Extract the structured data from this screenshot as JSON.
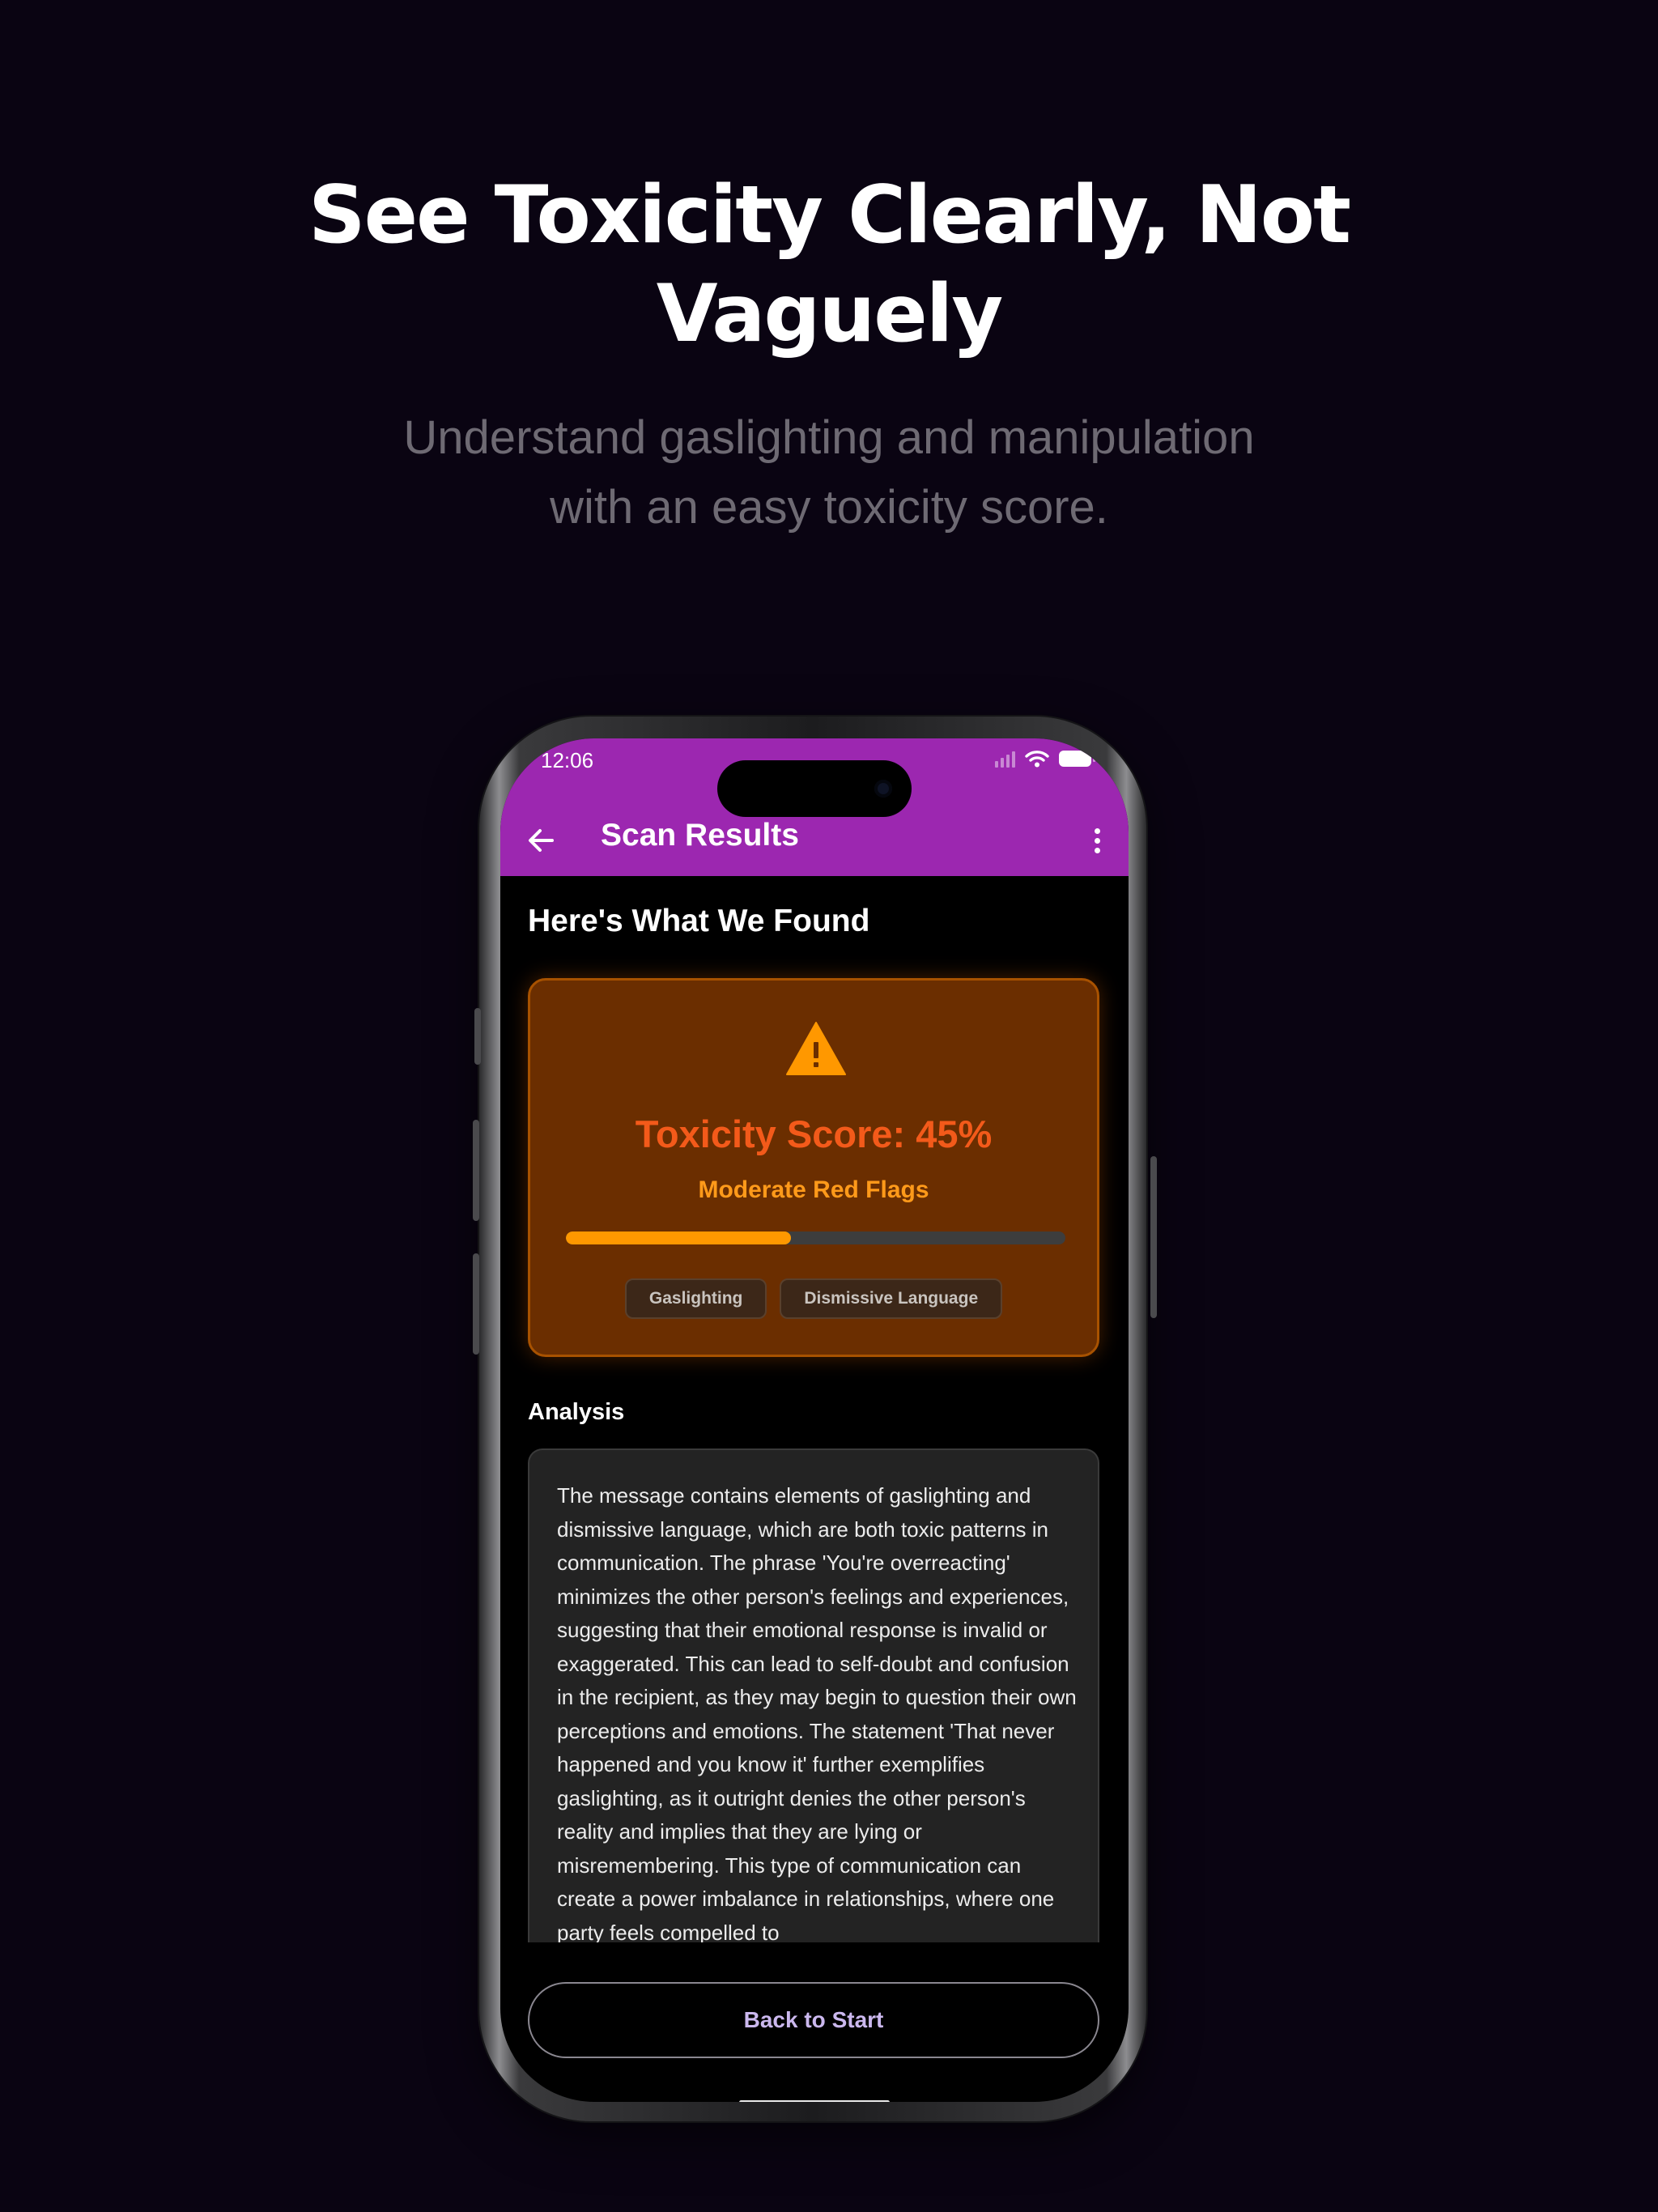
{
  "marketing": {
    "headline_line1": "See Toxicity Clearly, Not",
    "headline_line2": "Vaguely",
    "subtitle_line1": "Understand gaslighting and manipulation",
    "subtitle_line2": "with an easy toxicity score."
  },
  "status_bar": {
    "time": "12:06",
    "icons": [
      "cellular-signal-icon",
      "wifi-icon",
      "battery-icon"
    ]
  },
  "app_bar": {
    "title": "Scan Results",
    "background_color": "#9c27b0",
    "back_icon": "arrow-left-icon",
    "menu_icon": "more-vertical-icon"
  },
  "results": {
    "heading": "Here's What We Found",
    "score": {
      "icon": "warning-triangle-icon",
      "label": "Toxicity Score: 45%",
      "value_percent": 45,
      "level": "Moderate Red Flags",
      "accent_color": "#ff9800",
      "tags": [
        "Gaslighting",
        "Dismissive Language"
      ]
    },
    "analysis": {
      "label": "Analysis",
      "text": "The message contains elements of gaslighting and dismissive language, which are both toxic patterns in communication. The phrase 'You're overreacting' minimizes the other person's feelings and experiences, suggesting that their emotional response is invalid or exaggerated. This can lead to self-doubt and confusion in the recipient, as they may begin to question their own perceptions and emotions. The statement 'That never happened and you know it' further exemplifies gaslighting, as it outright denies the other person's reality and implies that they are lying or misremembering. This type of communication can create a power imbalance in relationships, where one party feels compelled to"
    },
    "back_button_label": "Back to Start"
  }
}
